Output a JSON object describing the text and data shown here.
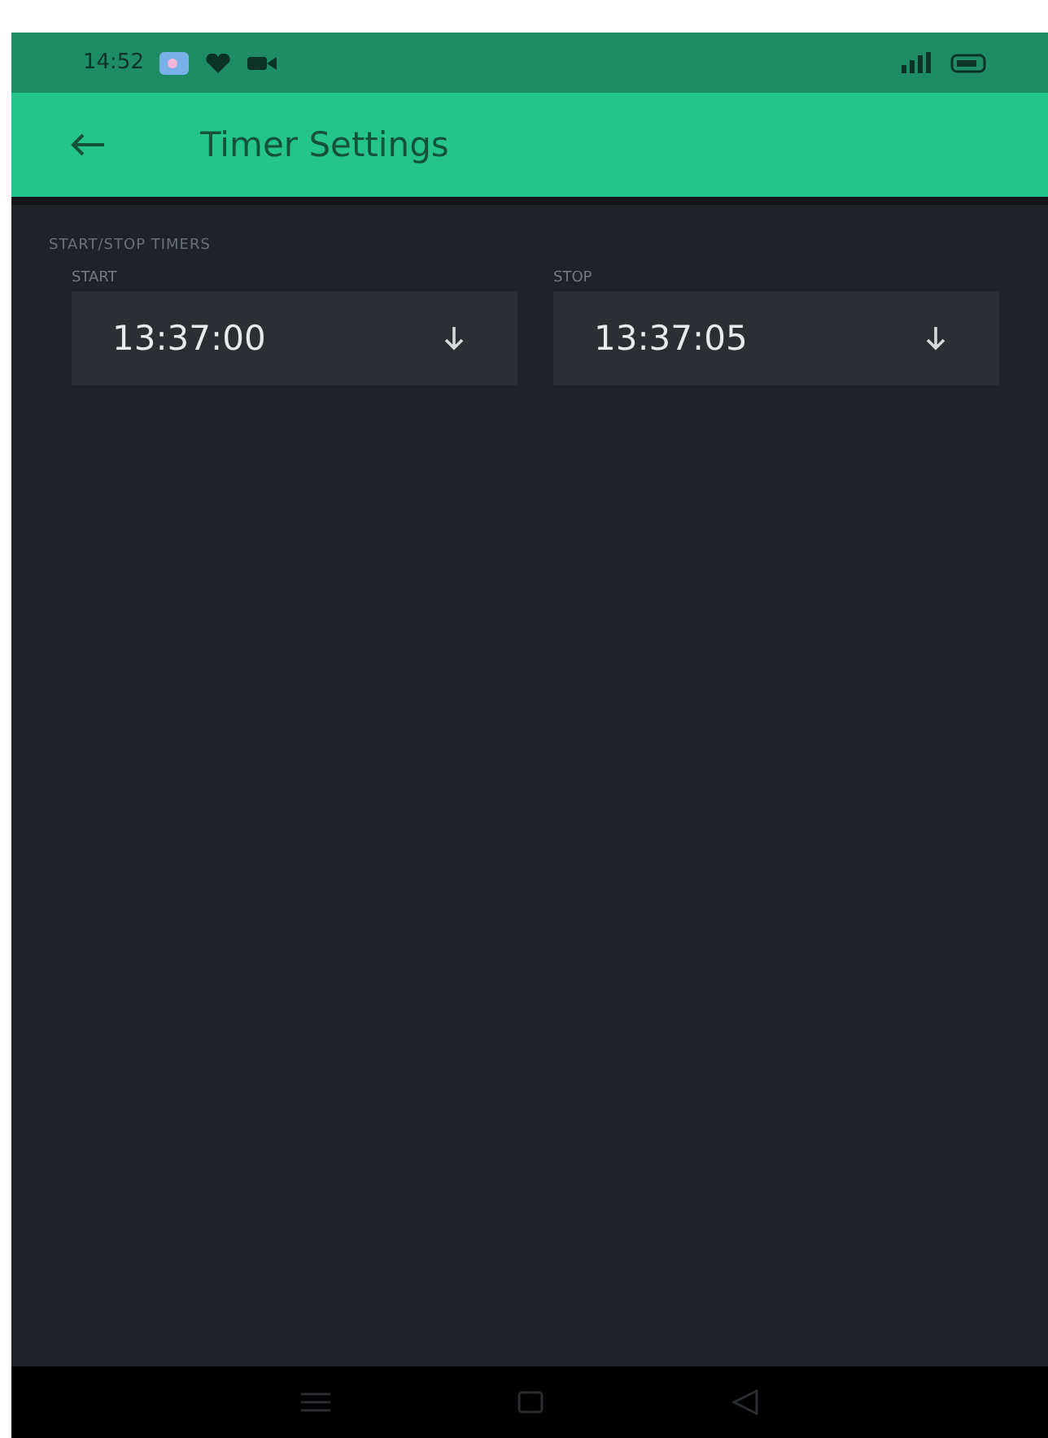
{
  "status_bar": {
    "time": "14:52"
  },
  "app_bar": {
    "title": "Timer Settings"
  },
  "section": {
    "title": "START/STOP TIMERS",
    "fields": [
      {
        "label": "START",
        "value": "13:37:00"
      },
      {
        "label": "STOP",
        "value": "13:37:05"
      }
    ]
  }
}
